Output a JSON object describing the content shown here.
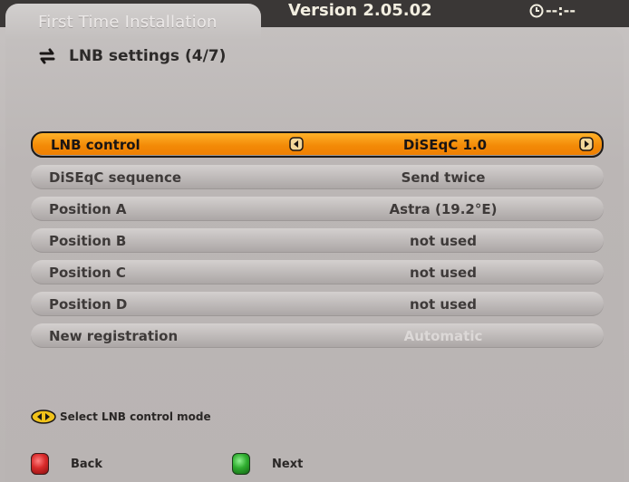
{
  "header": {
    "title": "First Time Installation",
    "version": "Version 2.05.02",
    "clock": "--:--"
  },
  "page": {
    "title": "LNB settings (4/7)"
  },
  "rows": [
    {
      "label": "LNB control",
      "value": "DiSEqC 1.0",
      "active": true
    },
    {
      "label": "DiSEqC sequence",
      "value": "Send twice"
    },
    {
      "label": "Position A",
      "value": "Astra (19.2°E)"
    },
    {
      "label": "Position B",
      "value": "not used"
    },
    {
      "label": "Position C",
      "value": "not used"
    },
    {
      "label": "Position D",
      "value": "not used"
    },
    {
      "label": "New registration",
      "value": "Automatic",
      "disabled": true
    }
  ],
  "hint": {
    "text": "Select LNB control mode"
  },
  "footer": {
    "back_label": "Back",
    "next_label": "Next"
  },
  "colors": {
    "active_row": "#f38a07",
    "back_key": "#d92a2a",
    "next_key": "#2fae2f"
  },
  "icons": {
    "subheader": "lnb-arrows-icon",
    "clock": "clock-icon",
    "left": "left-arrow-icon",
    "right": "right-arrow-icon",
    "hint": "left-right-keys-icon"
  }
}
